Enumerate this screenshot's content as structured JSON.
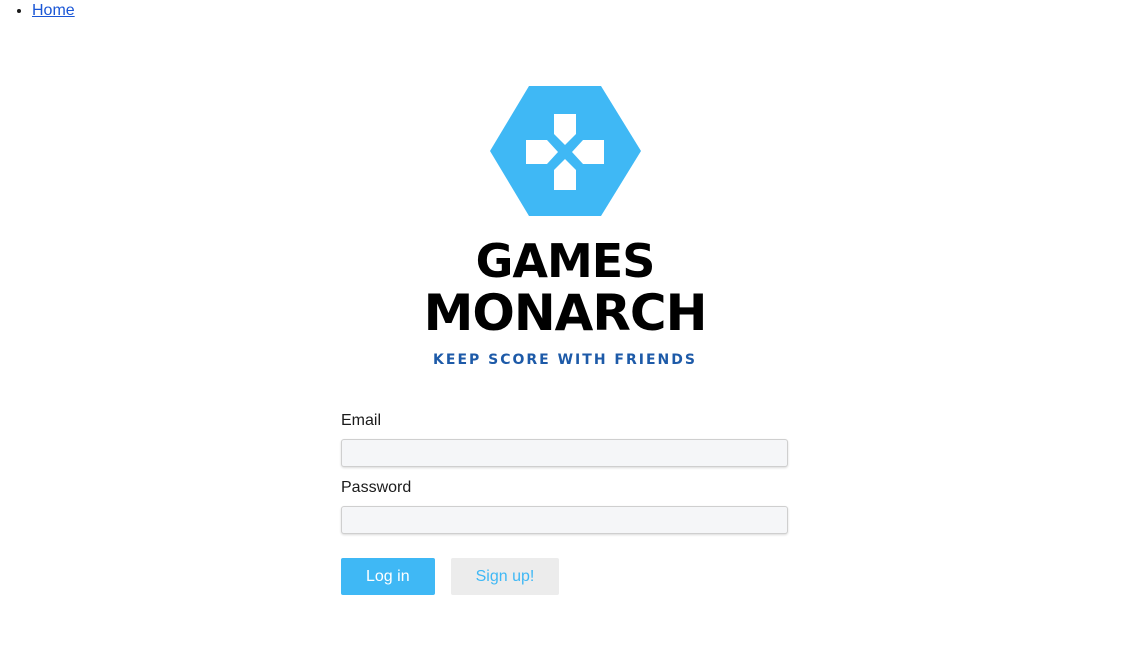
{
  "nav": {
    "items": [
      {
        "label": "Home"
      }
    ]
  },
  "brand": {
    "line1": "GAMES",
    "line2": "MONARCH",
    "tagline": "KEEP SCORE WITH FRIENDS",
    "icon": "gamepad-hexagon-icon",
    "accent_color": "#3fb8f5",
    "tagline_color": "#1d5aa8"
  },
  "form": {
    "email_label": "Email",
    "email_value": "",
    "password_label": "Password",
    "password_value": ""
  },
  "buttons": {
    "login_label": "Log in",
    "signup_label": "Sign up!"
  }
}
